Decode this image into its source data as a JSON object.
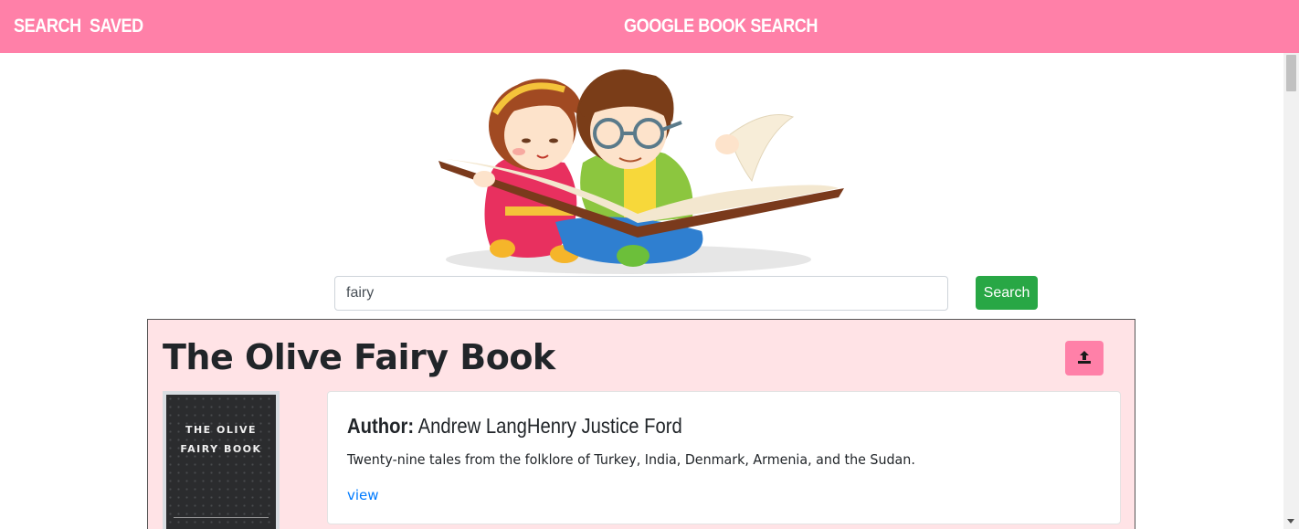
{
  "navbar": {
    "links": [
      {
        "label": "SEARCH"
      },
      {
        "label": "SAVED"
      }
    ],
    "brand": "GOOGLE BOOK SEARCH"
  },
  "hero": {
    "icon": "children-reading-book-illustration"
  },
  "search": {
    "value": "fairy",
    "button_label": "Search"
  },
  "results": [
    {
      "title": "The Olive Fairy Book",
      "save_icon": "upload-icon",
      "cover_text_line1": "THE OLIVE",
      "cover_text_line2": "FAIRY BOOK",
      "author_label": "Author:",
      "author": "Andrew LangHenry Justice Ford",
      "description": "Twenty-nine tales from the folklore of Turkey, India, Denmark, Armenia, and the Sudan.",
      "link_label": "view"
    }
  ],
  "colors": {
    "navbar": "#ff80a8",
    "card_bg": "#ffe3e6",
    "search_button": "#28a745",
    "link": "#007bff"
  }
}
